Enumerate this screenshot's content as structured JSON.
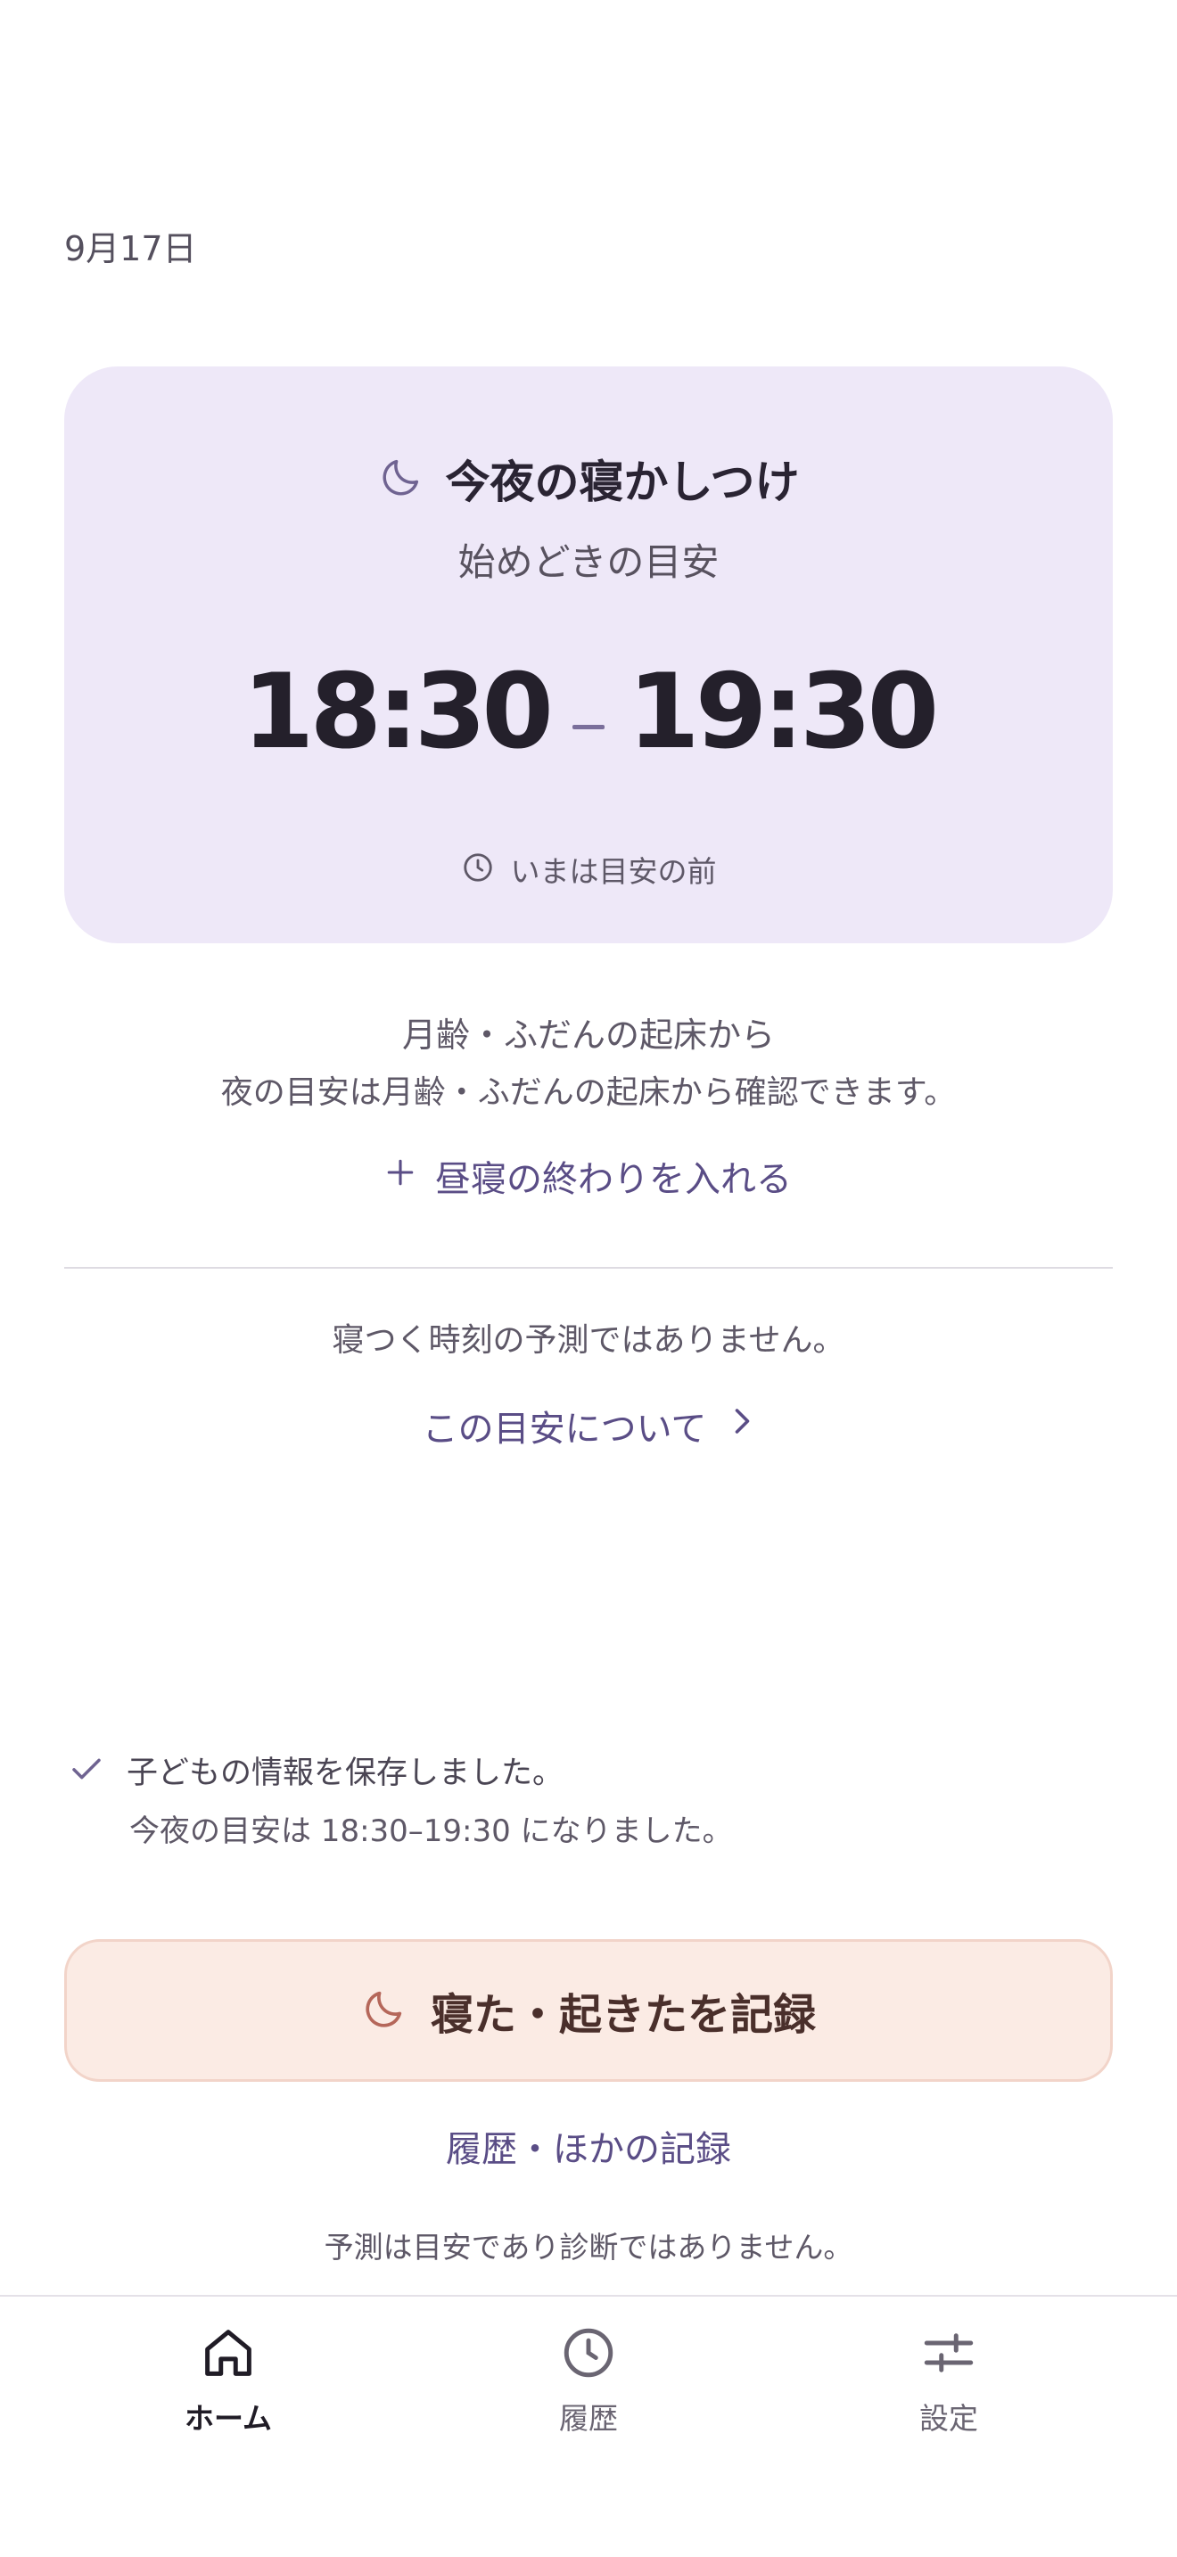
{
  "date": "9月17日",
  "card": {
    "title": "今夜の寝かしつけ",
    "subtitle": "始めどきの目安",
    "time_start": "18:30",
    "time_end": "19:30",
    "status": "いまは目安の前"
  },
  "info": {
    "line1": "月齢・ふだんの起床から",
    "line2": "夜の目安は月齢・ふだんの起床から確認できます。",
    "nap_link": "昼寝の終わりを入れる",
    "not_prediction": "寝つく時刻の予測ではありません。",
    "about_link": "この目安について"
  },
  "toast": {
    "title": "子どもの情報を保存しました。",
    "detail": "今夜の目安は 18:30–19:30 になりました。"
  },
  "record_button": "寝た・起きたを記録",
  "history_link": "履歴・ほかの記録",
  "disclaimer": "予測は目安であり診断ではありません。",
  "nav": [
    {
      "label": "ホーム",
      "icon": "home-icon",
      "active": true
    },
    {
      "label": "履歴",
      "icon": "clock-icon",
      "active": false
    },
    {
      "label": "設定",
      "icon": "sliders-icon",
      "active": false
    }
  ],
  "colors": {
    "card_bg": "#eee8f8",
    "accent": "#5a4d86",
    "record_bg": "#fbebe4",
    "record_icon": "#b5675a"
  }
}
